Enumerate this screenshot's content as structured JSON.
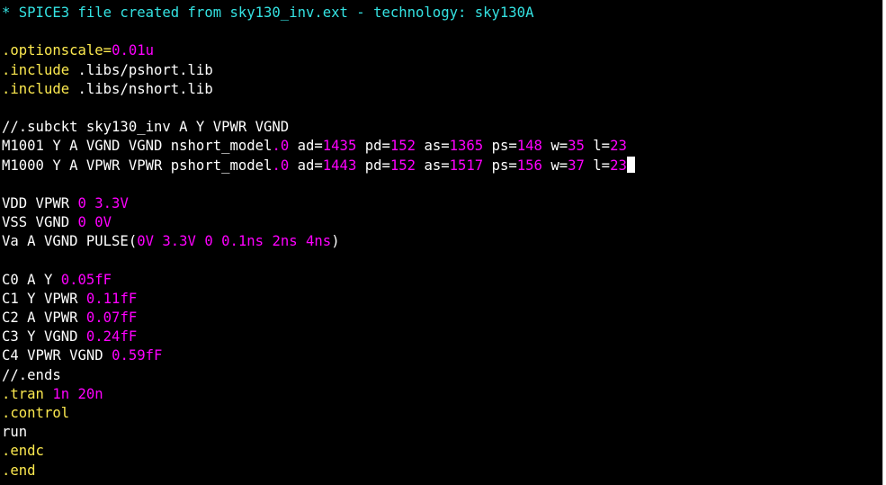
{
  "colors": {
    "background": "#000000",
    "default": "#ffffff",
    "comment": "#34e2e2",
    "directive": "#fce94f",
    "number": "#ff00ff"
  },
  "lines": [
    [
      {
        "t": "* SPICE3 file created from sky130_inv.ext - technology: sky130A",
        "c": "comment"
      }
    ],
    [],
    [
      {
        "t": ".option",
        "c": "directive"
      },
      {
        "t": "scale=",
        "c": "directive"
      },
      {
        "t": "0.01u",
        "c": "number"
      }
    ],
    [
      {
        "t": ".include",
        "c": "directive"
      },
      {
        "t": " .libs/pshort.lib",
        "c": "default"
      }
    ],
    [
      {
        "t": ".include",
        "c": "directive"
      },
      {
        "t": " .libs/nshort.lib",
        "c": "default"
      }
    ],
    [],
    [
      {
        "t": "//.subckt sky130_inv A Y VPWR VGND",
        "c": "default"
      }
    ],
    [
      {
        "t": "M1001 Y A VGND VGND nshort_model",
        "c": "default"
      },
      {
        "t": ".0",
        "c": "number"
      },
      {
        "t": " ad=",
        "c": "default"
      },
      {
        "t": "1435",
        "c": "number"
      },
      {
        "t": " pd=",
        "c": "default"
      },
      {
        "t": "152",
        "c": "number"
      },
      {
        "t": " as=",
        "c": "default"
      },
      {
        "t": "1365",
        "c": "number"
      },
      {
        "t": " ps=",
        "c": "default"
      },
      {
        "t": "148",
        "c": "number"
      },
      {
        "t": " w=",
        "c": "default"
      },
      {
        "t": "35",
        "c": "number"
      },
      {
        "t": " l=",
        "c": "default"
      },
      {
        "t": "23",
        "c": "number"
      }
    ],
    [
      {
        "t": "M1000 Y A VPWR VPWR pshort_model",
        "c": "default"
      },
      {
        "t": ".0",
        "c": "number"
      },
      {
        "t": " ad=",
        "c": "default"
      },
      {
        "t": "1443",
        "c": "number"
      },
      {
        "t": " pd=",
        "c": "default"
      },
      {
        "t": "152",
        "c": "number"
      },
      {
        "t": " as=",
        "c": "default"
      },
      {
        "t": "1517",
        "c": "number"
      },
      {
        "t": " ps=",
        "c": "default"
      },
      {
        "t": "156",
        "c": "number"
      },
      {
        "t": " w=",
        "c": "default"
      },
      {
        "t": "37",
        "c": "number"
      },
      {
        "t": " l=",
        "c": "default"
      },
      {
        "t": "23",
        "c": "number"
      }
    ],
    [],
    [
      {
        "t": "VDD VPWR ",
        "c": "default"
      },
      {
        "t": "0",
        "c": "number"
      },
      {
        "t": " ",
        "c": "default"
      },
      {
        "t": "3.3V",
        "c": "number"
      }
    ],
    [
      {
        "t": "VSS VGND ",
        "c": "default"
      },
      {
        "t": "0",
        "c": "number"
      },
      {
        "t": " ",
        "c": "default"
      },
      {
        "t": "0V",
        "c": "number"
      }
    ],
    [
      {
        "t": "Va A VGND PULSE(",
        "c": "default"
      },
      {
        "t": "0V",
        "c": "number"
      },
      {
        "t": " ",
        "c": "default"
      },
      {
        "t": "3.3V",
        "c": "number"
      },
      {
        "t": " ",
        "c": "default"
      },
      {
        "t": "0",
        "c": "number"
      },
      {
        "t": " ",
        "c": "default"
      },
      {
        "t": "0.1ns",
        "c": "number"
      },
      {
        "t": " ",
        "c": "default"
      },
      {
        "t": "2ns",
        "c": "number"
      },
      {
        "t": " ",
        "c": "default"
      },
      {
        "t": "4ns",
        "c": "number"
      },
      {
        "t": ")",
        "c": "default"
      }
    ],
    [],
    [
      {
        "t": "C0 A Y ",
        "c": "default"
      },
      {
        "t": "0.05fF",
        "c": "number"
      }
    ],
    [
      {
        "t": "C1 Y VPWR ",
        "c": "default"
      },
      {
        "t": "0.11fF",
        "c": "number"
      }
    ],
    [
      {
        "t": "C2 A VPWR ",
        "c": "default"
      },
      {
        "t": "0.07fF",
        "c": "number"
      }
    ],
    [
      {
        "t": "C3 Y VGND ",
        "c": "default"
      },
      {
        "t": "0.24fF",
        "c": "number"
      }
    ],
    [
      {
        "t": "C4 VPWR VGND ",
        "c": "default"
      },
      {
        "t": "0.59fF",
        "c": "number"
      }
    ],
    [
      {
        "t": "//.ends",
        "c": "default"
      }
    ],
    [
      {
        "t": ".tran",
        "c": "directive"
      },
      {
        "t": " ",
        "c": "default"
      },
      {
        "t": "1n",
        "c": "number"
      },
      {
        "t": " ",
        "c": "default"
      },
      {
        "t": "20n",
        "c": "number"
      }
    ],
    [
      {
        "t": ".control",
        "c": "directive"
      }
    ],
    [
      {
        "t": "run",
        "c": "default"
      }
    ],
    [
      {
        "t": ".endc",
        "c": "directive"
      }
    ],
    [
      {
        "t": ".end",
        "c": "directive"
      }
    ]
  ],
  "cursor_line": 8
}
